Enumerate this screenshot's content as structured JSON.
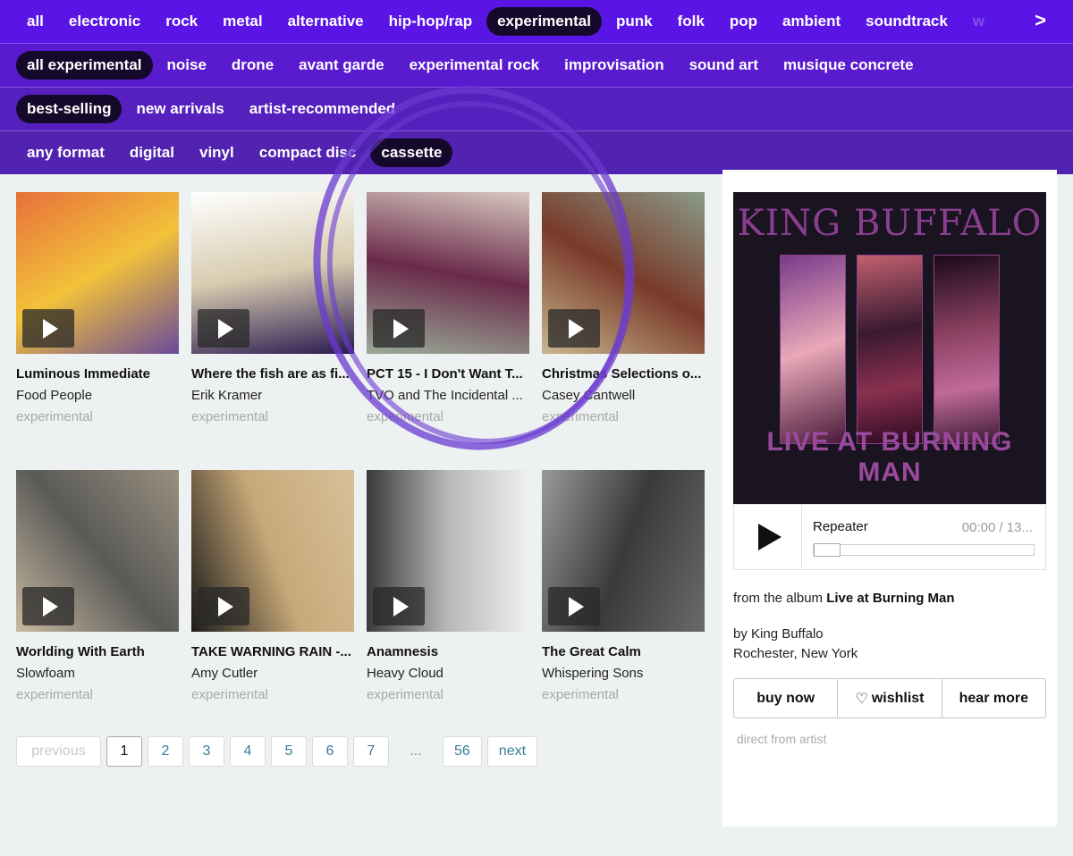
{
  "nav": {
    "genres": [
      "all",
      "electronic",
      "rock",
      "metal",
      "alternative",
      "hip-hop/rap",
      "experimental",
      "punk",
      "folk",
      "pop",
      "ambient",
      "soundtrack",
      "w"
    ],
    "genres_active": 6,
    "next_label": ">",
    "subgenres": [
      "all experimental",
      "noise",
      "drone",
      "avant garde",
      "experimental rock",
      "improvisation",
      "sound art",
      "musique concrete"
    ],
    "subgenres_active": 0,
    "sort": [
      "best-selling",
      "new arrivals",
      "artist-recommended"
    ],
    "sort_active": 0,
    "formats": [
      "any format",
      "digital",
      "vinyl",
      "compact disc",
      "cassette"
    ],
    "formats_active": 4
  },
  "items": [
    {
      "title": "Luminous Immediate",
      "artist": "Food People",
      "genre": "experimental",
      "art_colors": [
        "#e8703a",
        "#f2c23a",
        "#6a4a9a"
      ]
    },
    {
      "title": "Where the fish are as fi...",
      "artist": "Erik Kramer",
      "genre": "experimental",
      "art_colors": [
        "#ffffff",
        "#d8ccb0",
        "#2a1a50"
      ]
    },
    {
      "title": "PCT 15 - I Don't Want T...",
      "artist": "TVO and The Incidental ...",
      "genre": "experimental",
      "art_colors": [
        "#d8c8c0",
        "#6a2a4a",
        "#9aaa98"
      ]
    },
    {
      "title": "Christmas Selections o...",
      "artist": "Casey Cantwell",
      "genre": "experimental",
      "art_colors": [
        "#8a9a88",
        "#7a3a2a",
        "#c8b890"
      ]
    },
    {
      "title": "Worlding With Earth",
      "artist": "Slowfoam",
      "genre": "experimental",
      "art_colors": [
        "#9a9080",
        "#5a5a58",
        "#c8b8a0"
      ]
    },
    {
      "title": "TAKE WARNING RAIN -...",
      "artist": "Amy Cutler",
      "genre": "experimental",
      "art_colors": [
        "#d8c09a",
        "#c8a878",
        "#1a1a18"
      ]
    },
    {
      "title": "Anamnesis",
      "artist": "Heavy Cloud",
      "genre": "experimental",
      "art_colors": [
        "#f0f0f0",
        "#b8b8b8",
        "#3a3a3a"
      ]
    },
    {
      "title": "The Great Calm",
      "artist": "Whispering Sons",
      "genre": "experimental",
      "art_colors": [
        "#6a6a68",
        "#3a3a38",
        "#9a9a98"
      ]
    }
  ],
  "pagination": {
    "previous": "previous",
    "pages": [
      "1",
      "2",
      "3",
      "4",
      "5",
      "6",
      "7"
    ],
    "current": "1",
    "ellipsis": "...",
    "last": "56",
    "next": "next"
  },
  "featured": {
    "band_art_text": "KING BUFFALO",
    "album_art_text": "LIVE AT BURNING MAN",
    "track": "Repeater",
    "time": "00:00 / 13...",
    "progress": 0,
    "from_prefix": "from the album",
    "album": "Live at Burning Man",
    "by": "by King Buffalo",
    "location": "Rochester, New York",
    "buy": "buy now",
    "wishlist": "wishlist",
    "hear_more": "hear more",
    "direct": "direct from artist"
  },
  "annotation": {
    "color": "#6a3ad0"
  }
}
